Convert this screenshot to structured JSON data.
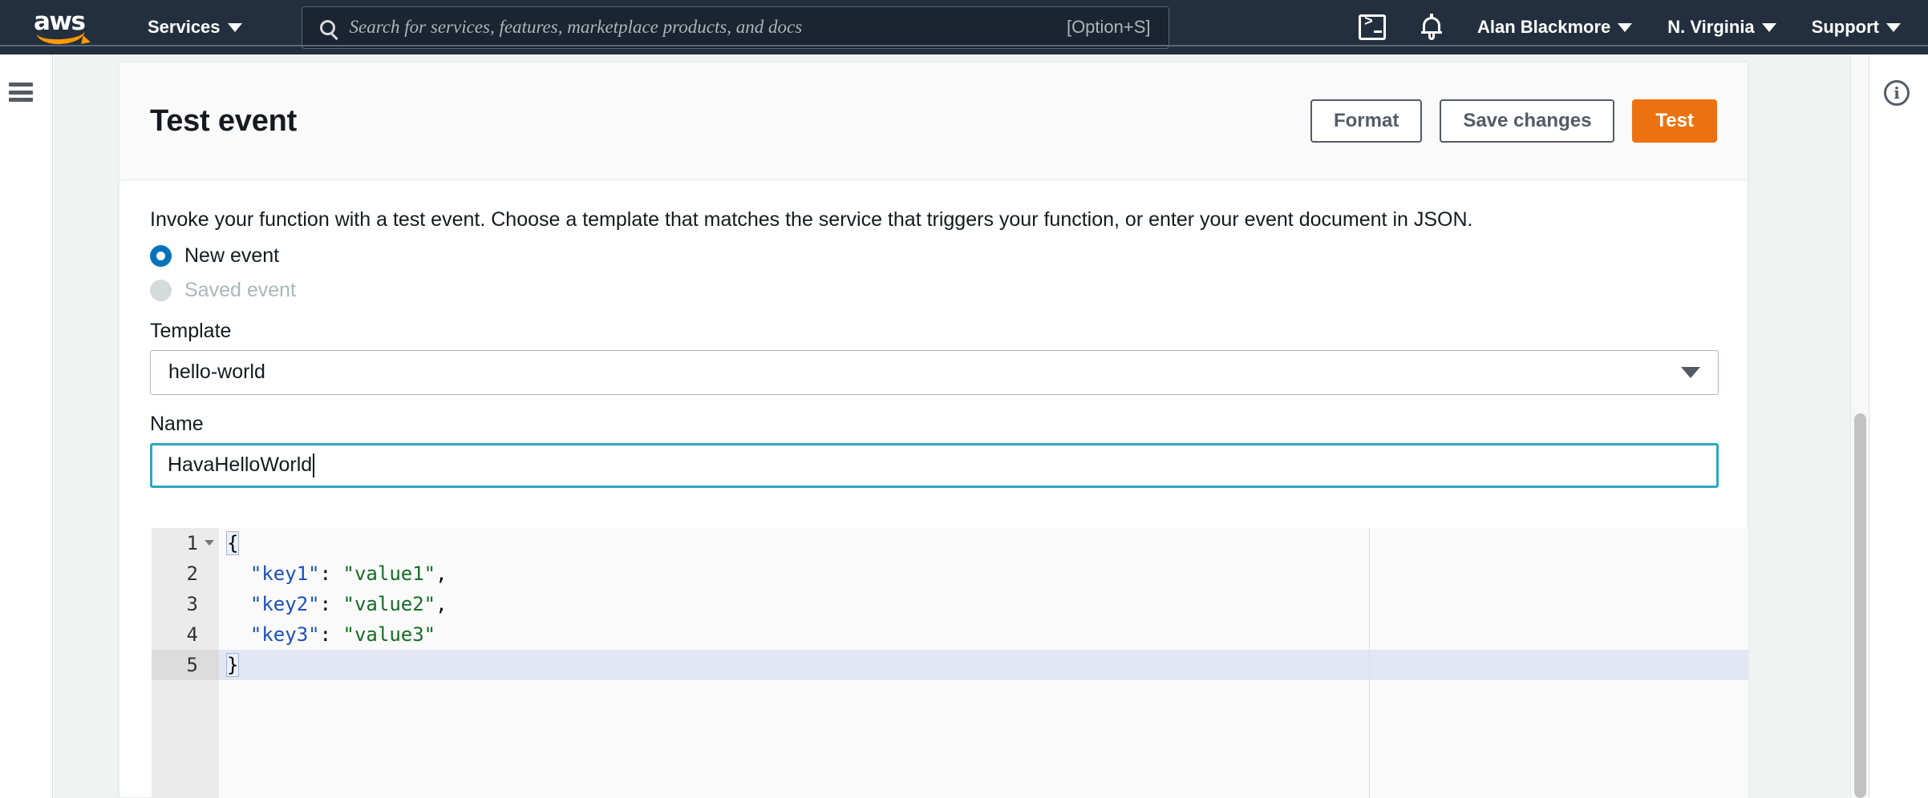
{
  "topnav": {
    "logo_alt": "aws",
    "services_label": "Services",
    "search": {
      "placeholder": "Search for services, features, marketplace products, and docs",
      "shortcut": "[Option+S]",
      "value": ""
    },
    "cloudshell_icon": "cloudshell-icon",
    "notifications_icon": "bell-icon",
    "account_label": "Alan Blackmore",
    "region_label": "N. Virginia",
    "support_label": "Support"
  },
  "rails": {
    "menu_icon": "hamburger-icon",
    "info_icon": "info-circle-icon"
  },
  "card": {
    "title": "Test event",
    "actions": {
      "format_label": "Format",
      "save_changes_label": "Save changes",
      "test_label": "Test"
    },
    "description": "Invoke your function with a test event. Choose a template that matches the service that triggers your function, or enter your event document in JSON.",
    "event_source": {
      "new_event_label": "New event",
      "new_event_selected": true,
      "saved_event_label": "Saved event",
      "saved_event_disabled": true
    },
    "template": {
      "label": "Template",
      "value": "hello-world",
      "caret_icon": "chevron-down-icon"
    },
    "name": {
      "label": "Name",
      "value": "HavaHelloWorld",
      "focused": true
    }
  },
  "editor": {
    "active_line": 5,
    "gutter": [
      "1",
      "2",
      "3",
      "4",
      "5"
    ],
    "lines": [
      {
        "n": 1,
        "tokens": [
          {
            "t": "{",
            "c": "punct brace"
          }
        ]
      },
      {
        "n": 2,
        "tokens": [
          {
            "t": "  ",
            "c": "punct"
          },
          {
            "t": "\"key1\"",
            "c": "key"
          },
          {
            "t": ": ",
            "c": "punct"
          },
          {
            "t": "\"value1\"",
            "c": "str"
          },
          {
            "t": ",",
            "c": "punct"
          }
        ]
      },
      {
        "n": 3,
        "tokens": [
          {
            "t": "  ",
            "c": "punct"
          },
          {
            "t": "\"key2\"",
            "c": "key"
          },
          {
            "t": ": ",
            "c": "punct"
          },
          {
            "t": "\"value2\"",
            "c": "str"
          },
          {
            "t": ",",
            "c": "punct"
          }
        ]
      },
      {
        "n": 4,
        "tokens": [
          {
            "t": "  ",
            "c": "punct"
          },
          {
            "t": "\"key3\"",
            "c": "key"
          },
          {
            "t": ": ",
            "c": "punct"
          },
          {
            "t": "\"value3\"",
            "c": "str"
          }
        ]
      },
      {
        "n": 5,
        "tokens": [
          {
            "t": "}",
            "c": "punct brace"
          }
        ]
      }
    ],
    "raw_text": "{\n  \"key1\": \"value1\",\n  \"key2\": \"value2\",\n  \"key3\": \"value3\"\n}"
  },
  "colors": {
    "nav_bg": "#232f3e",
    "accent_orange": "#ec7211",
    "radio_blue": "#0073bb",
    "focus_teal": "#2ea7bf",
    "json_key": "#1a4fbb",
    "json_string": "#176b26",
    "page_bg": "#f1f3f3"
  },
  "scrollbar": {
    "orientation": "vertical",
    "thumb_position_pct": 48
  }
}
